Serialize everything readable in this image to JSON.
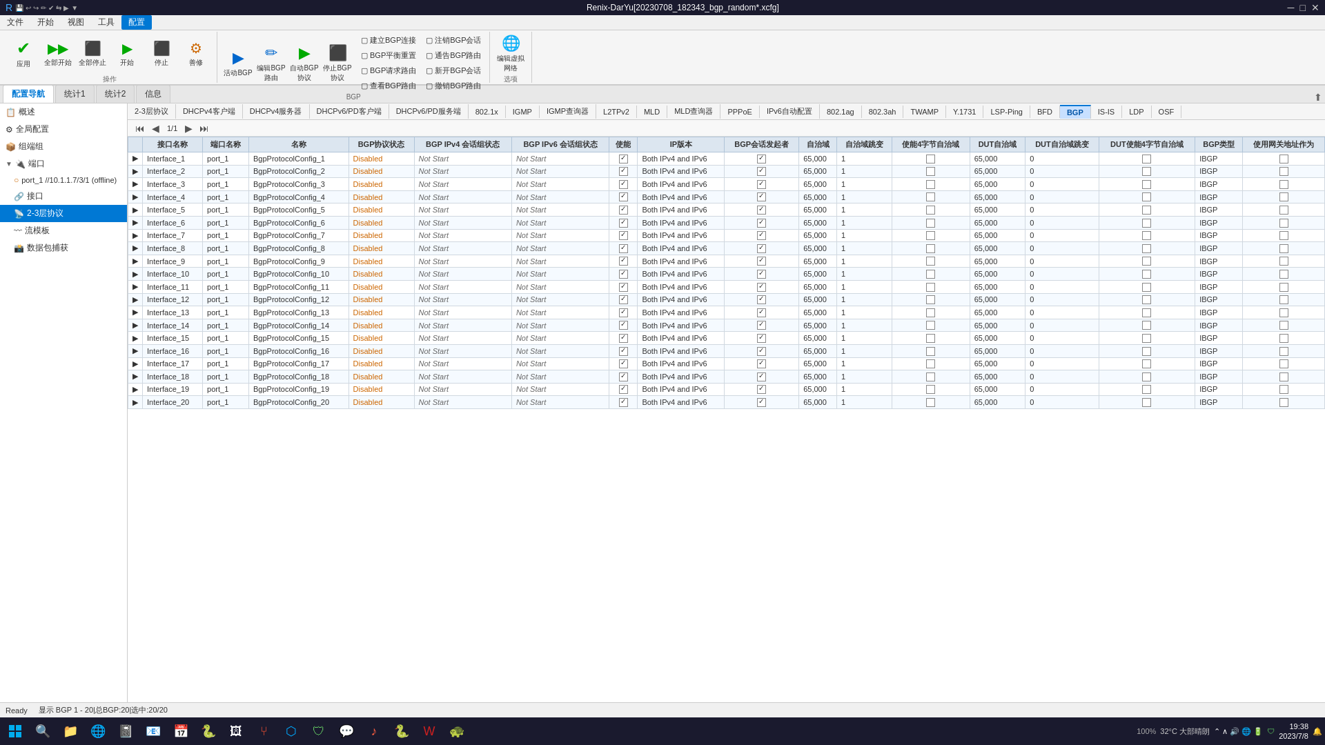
{
  "window": {
    "title": "Renix-DarYu[20230708_182343_bgp_random*.xcfg]",
    "min_btn": "─",
    "max_btn": "□",
    "close_btn": "✕"
  },
  "menu": {
    "items": [
      "文件",
      "开始",
      "视图",
      "工具",
      "配置"
    ]
  },
  "toolbar": {
    "groups": [
      {
        "label": "操作",
        "buttons": [
          {
            "id": "apply",
            "label": "应用",
            "icon": "✔"
          },
          {
            "id": "run-all",
            "label": "全部开始",
            "icon": "▶▶"
          },
          {
            "id": "stop-all",
            "label": "全部停止",
            "icon": "■"
          },
          {
            "id": "start",
            "label": "开始",
            "icon": "▶"
          },
          {
            "id": "stop",
            "label": "停止",
            "icon": "⬛"
          },
          {
            "id": "repair",
            "label": "善修",
            "icon": "⚙"
          }
        ]
      }
    ],
    "bgp_group": {
      "label": "BGP",
      "top": [
        {
          "id": "activate-bgp",
          "label": "活动BGP",
          "icon": "▶"
        },
        {
          "id": "edit-bgp-route",
          "label": "编辑BGP路由",
          "icon": "✏"
        },
        {
          "id": "auto-bgp-auth",
          "label": "自动BGP协议",
          "icon": "▶"
        },
        {
          "id": "stop-bgp-auth",
          "label": "停止BGP协议",
          "icon": "⬛"
        }
      ],
      "bottom_options": [
        {
          "id": "create-bgp-conn",
          "label": "建立BGP连接"
        },
        {
          "id": "bgp-balance-reset",
          "label": "BGP平衡重置"
        },
        {
          "id": "bgp-request-route",
          "label": "BGP请求路由"
        },
        {
          "id": "check-bgp-route",
          "label": "查看BGP路由"
        },
        {
          "id": "block-bgp-session",
          "label": "注销BGP会话"
        },
        {
          "id": "pass-bgp-route",
          "label": "通告BGP路由"
        },
        {
          "id": "open-bgp-session",
          "label": "新开BGP会话"
        },
        {
          "id": "withdraw-bgp-route",
          "label": "撤销BGP路由"
        }
      ]
    },
    "options_group": {
      "label": "选项",
      "buttons": [
        {
          "id": "edit-virtual-network",
          "label": "编辑虚拟网络",
          "icon": "🌐"
        }
      ]
    }
  },
  "tabs": {
    "items": [
      "配置导航",
      "统计1",
      "统计2",
      "信息"
    ],
    "active": "配置导航"
  },
  "sidebar": {
    "items": [
      {
        "id": "overview",
        "label": "概述",
        "level": 0,
        "icon": "📋",
        "expanded": false
      },
      {
        "id": "full-config",
        "label": "全局配置",
        "level": 0,
        "icon": "⚙",
        "expanded": false
      },
      {
        "id": "chassis-group",
        "label": "组端组",
        "level": 0,
        "icon": "📦",
        "expanded": false
      },
      {
        "id": "port-group",
        "label": "端口",
        "level": 0,
        "icon": "🔌",
        "expanded": true
      },
      {
        "id": "port1",
        "label": "port_1 //10.1.1.7/3/1 (offline)",
        "level": 1,
        "icon": "○"
      },
      {
        "id": "interface-group",
        "label": "接口",
        "level": 1,
        "icon": "🔗",
        "expanded": false
      },
      {
        "id": "protocol-2-3",
        "label": "2-3层协议",
        "level": 1,
        "icon": "📡",
        "active": true
      },
      {
        "id": "flow-model",
        "label": "流模板",
        "level": 1,
        "icon": "〰"
      },
      {
        "id": "packet-capture",
        "label": "数据包捕获",
        "level": 1,
        "icon": "📸"
      }
    ]
  },
  "protocol_tabs": {
    "items": [
      "2-3层协议",
      "DHCPv4客户端",
      "DHCPv4服务器",
      "DHCPv6/PD客户端",
      "DHCPv6/PD服务端",
      "802.1x",
      "IGMP",
      "IGMP查询器",
      "L2TPv2",
      "MLD",
      "MLD查询器",
      "PPPoE",
      "IPv6自动配置",
      "802.1ag",
      "802.3ah",
      "TWAMP",
      "Y.1731",
      "LSP-Ping",
      "BFD",
      "BGP",
      "IS-IS",
      "LDP",
      "OSF"
    ],
    "active": "BGP"
  },
  "pagination": {
    "current": "1/1",
    "first_btn": "⏮",
    "prev_btn": "◀",
    "next_btn": "▶",
    "last_btn": "⏭"
  },
  "table": {
    "columns": [
      "",
      "接口名称",
      "端口名称",
      "名称",
      "BGP协议状态",
      "BGP IPv4 会话组状态",
      "BGP IPv6 会话组状态",
      "使能",
      "IP版本",
      "BGP会话发起者",
      "自治域",
      "自治域跳变",
      "使能4字节自治域",
      "DUT自治域",
      "DUT自治域跳变",
      "DUT使能4字节自治域",
      "BGP类型",
      "使用网关地址作为"
    ],
    "rows": [
      {
        "interface": "Interface_1",
        "port": "port_1",
        "name": "BgpProtocolConfig_1",
        "bgp_status": "Disabled",
        "bgp_ipv4": "Not Start",
        "bgp_ipv6": "Not Start",
        "enabled": true,
        "ip_ver": "Both IPv4 and IPv6",
        "initiator": true,
        "asn": "65,000",
        "asn_hop": "1",
        "en4byte": false,
        "dut_asn": "65,000",
        "dut_hop": "0",
        "dut_en4byte": false,
        "bgp_type": "IBGP",
        "use_gw": false
      },
      {
        "interface": "Interface_2",
        "port": "port_1",
        "name": "BgpProtocolConfig_2",
        "bgp_status": "Disabled",
        "bgp_ipv4": "Not Start",
        "bgp_ipv6": "Not Start",
        "enabled": true,
        "ip_ver": "Both IPv4 and IPv6",
        "initiator": true,
        "asn": "65,000",
        "asn_hop": "1",
        "en4byte": false,
        "dut_asn": "65,000",
        "dut_hop": "0",
        "dut_en4byte": false,
        "bgp_type": "IBGP",
        "use_gw": false
      },
      {
        "interface": "Interface_3",
        "port": "port_1",
        "name": "BgpProtocolConfig_3",
        "bgp_status": "Disabled",
        "bgp_ipv4": "Not Start",
        "bgp_ipv6": "Not Start",
        "enabled": true,
        "ip_ver": "Both IPv4 and IPv6",
        "initiator": true,
        "asn": "65,000",
        "asn_hop": "1",
        "en4byte": false,
        "dut_asn": "65,000",
        "dut_hop": "0",
        "dut_en4byte": false,
        "bgp_type": "IBGP",
        "use_gw": false
      },
      {
        "interface": "Interface_4",
        "port": "port_1",
        "name": "BgpProtocolConfig_4",
        "bgp_status": "Disabled",
        "bgp_ipv4": "Not Start",
        "bgp_ipv6": "Not Start",
        "enabled": true,
        "ip_ver": "Both IPv4 and IPv6",
        "initiator": true,
        "asn": "65,000",
        "asn_hop": "1",
        "en4byte": false,
        "dut_asn": "65,000",
        "dut_hop": "0",
        "dut_en4byte": false,
        "bgp_type": "IBGP",
        "use_gw": false
      },
      {
        "interface": "Interface_5",
        "port": "port_1",
        "name": "BgpProtocolConfig_5",
        "bgp_status": "Disabled",
        "bgp_ipv4": "Not Start",
        "bgp_ipv6": "Not Start",
        "enabled": true,
        "ip_ver": "Both IPv4 and IPv6",
        "initiator": true,
        "asn": "65,000",
        "asn_hop": "1",
        "en4byte": false,
        "dut_asn": "65,000",
        "dut_hop": "0",
        "dut_en4byte": false,
        "bgp_type": "IBGP",
        "use_gw": false
      },
      {
        "interface": "Interface_6",
        "port": "port_1",
        "name": "BgpProtocolConfig_6",
        "bgp_status": "Disabled",
        "bgp_ipv4": "Not Start",
        "bgp_ipv6": "Not Start",
        "enabled": true,
        "ip_ver": "Both IPv4 and IPv6",
        "initiator": true,
        "asn": "65,000",
        "asn_hop": "1",
        "en4byte": false,
        "dut_asn": "65,000",
        "dut_hop": "0",
        "dut_en4byte": false,
        "bgp_type": "IBGP",
        "use_gw": false
      },
      {
        "interface": "Interface_7",
        "port": "port_1",
        "name": "BgpProtocolConfig_7",
        "bgp_status": "Disabled",
        "bgp_ipv4": "Not Start",
        "bgp_ipv6": "Not Start",
        "enabled": true,
        "ip_ver": "Both IPv4 and IPv6",
        "initiator": true,
        "asn": "65,000",
        "asn_hop": "1",
        "en4byte": false,
        "dut_asn": "65,000",
        "dut_hop": "0",
        "dut_en4byte": false,
        "bgp_type": "IBGP",
        "use_gw": false
      },
      {
        "interface": "Interface_8",
        "port": "port_1",
        "name": "BgpProtocolConfig_8",
        "bgp_status": "Disabled",
        "bgp_ipv4": "Not Start",
        "bgp_ipv6": "Not Start",
        "enabled": true,
        "ip_ver": "Both IPv4 and IPv6",
        "initiator": true,
        "asn": "65,000",
        "asn_hop": "1",
        "en4byte": false,
        "dut_asn": "65,000",
        "dut_hop": "0",
        "dut_en4byte": false,
        "bgp_type": "IBGP",
        "use_gw": false
      },
      {
        "interface": "Interface_9",
        "port": "port_1",
        "name": "BgpProtocolConfig_9",
        "bgp_status": "Disabled",
        "bgp_ipv4": "Not Start",
        "bgp_ipv6": "Not Start",
        "enabled": true,
        "ip_ver": "Both IPv4 and IPv6",
        "initiator": true,
        "asn": "65,000",
        "asn_hop": "1",
        "en4byte": false,
        "dut_asn": "65,000",
        "dut_hop": "0",
        "dut_en4byte": false,
        "bgp_type": "IBGP",
        "use_gw": false
      },
      {
        "interface": "Interface_10",
        "port": "port_1",
        "name": "BgpProtocolConfig_10",
        "bgp_status": "Disabled",
        "bgp_ipv4": "Not Start",
        "bgp_ipv6": "Not Start",
        "enabled": true,
        "ip_ver": "Both IPv4 and IPv6",
        "initiator": true,
        "asn": "65,000",
        "asn_hop": "1",
        "en4byte": false,
        "dut_asn": "65,000",
        "dut_hop": "0",
        "dut_en4byte": false,
        "bgp_type": "IBGP",
        "use_gw": false
      },
      {
        "interface": "Interface_11",
        "port": "port_1",
        "name": "BgpProtocolConfig_11",
        "bgp_status": "Disabled",
        "bgp_ipv4": "Not Start",
        "bgp_ipv6": "Not Start",
        "enabled": true,
        "ip_ver": "Both IPv4 and IPv6",
        "initiator": true,
        "asn": "65,000",
        "asn_hop": "1",
        "en4byte": false,
        "dut_asn": "65,000",
        "dut_hop": "0",
        "dut_en4byte": false,
        "bgp_type": "IBGP",
        "use_gw": false
      },
      {
        "interface": "Interface_12",
        "port": "port_1",
        "name": "BgpProtocolConfig_12",
        "bgp_status": "Disabled",
        "bgp_ipv4": "Not Start",
        "bgp_ipv6": "Not Start",
        "enabled": true,
        "ip_ver": "Both IPv4 and IPv6",
        "initiator": true,
        "asn": "65,000",
        "asn_hop": "1",
        "en4byte": false,
        "dut_asn": "65,000",
        "dut_hop": "0",
        "dut_en4byte": false,
        "bgp_type": "IBGP",
        "use_gw": false
      },
      {
        "interface": "Interface_13",
        "port": "port_1",
        "name": "BgpProtocolConfig_13",
        "bgp_status": "Disabled",
        "bgp_ipv4": "Not Start",
        "bgp_ipv6": "Not Start",
        "enabled": true,
        "ip_ver": "Both IPv4 and IPv6",
        "initiator": true,
        "asn": "65,000",
        "asn_hop": "1",
        "en4byte": false,
        "dut_asn": "65,000",
        "dut_hop": "0",
        "dut_en4byte": false,
        "bgp_type": "IBGP",
        "use_gw": false
      },
      {
        "interface": "Interface_14",
        "port": "port_1",
        "name": "BgpProtocolConfig_14",
        "bgp_status": "Disabled",
        "bgp_ipv4": "Not Start",
        "bgp_ipv6": "Not Start",
        "enabled": true,
        "ip_ver": "Both IPv4 and IPv6",
        "initiator": true,
        "asn": "65,000",
        "asn_hop": "1",
        "en4byte": false,
        "dut_asn": "65,000",
        "dut_hop": "0",
        "dut_en4byte": false,
        "bgp_type": "IBGP",
        "use_gw": false
      },
      {
        "interface": "Interface_15",
        "port": "port_1",
        "name": "BgpProtocolConfig_15",
        "bgp_status": "Disabled",
        "bgp_ipv4": "Not Start",
        "bgp_ipv6": "Not Start",
        "enabled": true,
        "ip_ver": "Both IPv4 and IPv6",
        "initiator": true,
        "asn": "65,000",
        "asn_hop": "1",
        "en4byte": false,
        "dut_asn": "65,000",
        "dut_hop": "0",
        "dut_en4byte": false,
        "bgp_type": "IBGP",
        "use_gw": false
      },
      {
        "interface": "Interface_16",
        "port": "port_1",
        "name": "BgpProtocolConfig_16",
        "bgp_status": "Disabled",
        "bgp_ipv4": "Not Start",
        "bgp_ipv6": "Not Start",
        "enabled": true,
        "ip_ver": "Both IPv4 and IPv6",
        "initiator": true,
        "asn": "65,000",
        "asn_hop": "1",
        "en4byte": false,
        "dut_asn": "65,000",
        "dut_hop": "0",
        "dut_en4byte": false,
        "bgp_type": "IBGP",
        "use_gw": false
      },
      {
        "interface": "Interface_17",
        "port": "port_1",
        "name": "BgpProtocolConfig_17",
        "bgp_status": "Disabled",
        "bgp_ipv4": "Not Start",
        "bgp_ipv6": "Not Start",
        "enabled": true,
        "ip_ver": "Both IPv4 and IPv6",
        "initiator": true,
        "asn": "65,000",
        "asn_hop": "1",
        "en4byte": false,
        "dut_asn": "65,000",
        "dut_hop": "0",
        "dut_en4byte": false,
        "bgp_type": "IBGP",
        "use_gw": false
      },
      {
        "interface": "Interface_18",
        "port": "port_1",
        "name": "BgpProtocolConfig_18",
        "bgp_status": "Disabled",
        "bgp_ipv4": "Not Start",
        "bgp_ipv6": "Not Start",
        "enabled": true,
        "ip_ver": "Both IPv4 and IPv6",
        "initiator": true,
        "asn": "65,000",
        "asn_hop": "1",
        "en4byte": false,
        "dut_asn": "65,000",
        "dut_hop": "0",
        "dut_en4byte": false,
        "bgp_type": "IBGP",
        "use_gw": false
      },
      {
        "interface": "Interface_19",
        "port": "port_1",
        "name": "BgpProtocolConfig_19",
        "bgp_status": "Disabled",
        "bgp_ipv4": "Not Start",
        "bgp_ipv6": "Not Start",
        "enabled": true,
        "ip_ver": "Both IPv4 and IPv6",
        "initiator": true,
        "asn": "65,000",
        "asn_hop": "1",
        "en4byte": false,
        "dut_asn": "65,000",
        "dut_hop": "0",
        "dut_en4byte": false,
        "bgp_type": "IBGP",
        "use_gw": false
      },
      {
        "interface": "Interface_20",
        "port": "port_1",
        "name": "BgpProtocolConfig_20",
        "bgp_status": "Disabled",
        "bgp_ipv4": "Not Start",
        "bgp_ipv6": "Not Start",
        "enabled": true,
        "ip_ver": "Both IPv4 and IPv6",
        "initiator": true,
        "asn": "65,000",
        "asn_hop": "1",
        "en4byte": false,
        "dut_asn": "65,000",
        "dut_hop": "0",
        "dut_en4byte": false,
        "bgp_type": "IBGP",
        "use_gw": false
      }
    ]
  },
  "status_bar": {
    "ready": "Ready",
    "display_info": "显示 BGP 1 - 20|总BGP:20|选中:20/20"
  },
  "taskbar": {
    "time": "19:38",
    "date": "2023/7/8",
    "weather": "32°C 大部晴朗",
    "zoom": "100%"
  }
}
